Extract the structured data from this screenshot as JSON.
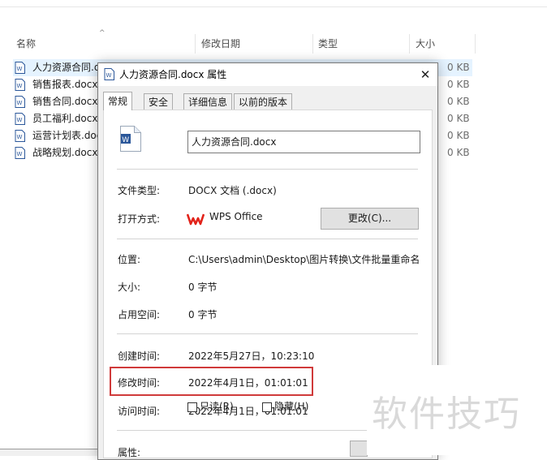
{
  "explorer": {
    "columns": {
      "name": "名称",
      "modified": "修改日期",
      "type": "类型",
      "size": "大小"
    },
    "files": [
      {
        "name": "人力资源合同.docx",
        "size": "0 KB",
        "selected": true
      },
      {
        "name": "销售报表.docx",
        "size": "0 KB",
        "selected": false
      },
      {
        "name": "销售合同.docx",
        "size": "0 KB",
        "selected": false
      },
      {
        "name": "员工福利.docx",
        "size": "0 KB",
        "selected": false
      },
      {
        "name": "运营计划表.docx",
        "size": "0 KB",
        "selected": false
      },
      {
        "name": "战略规划.docx",
        "size": "0 KB",
        "selected": false
      }
    ]
  },
  "dialog": {
    "title": "人力资源合同.docx 属性",
    "close_glyph": "✕",
    "tabs": [
      "常规",
      "安全",
      "详细信息",
      "以前的版本"
    ],
    "active_tab": "常规",
    "general": {
      "file_name": "人力资源合同.docx",
      "file_type_label": "文件类型:",
      "file_type_value": "DOCX 文档 (.docx)",
      "open_with_label": "打开方式:",
      "open_with_app": "WPS Office",
      "change_button": "更改(C)...",
      "location_label": "位置:",
      "location_value": "C:\\Users\\admin\\Desktop\\图片转换\\文件批量重命名",
      "size_label": "大小:",
      "size_value": "0 字节",
      "size_on_disk_label": "占用空间:",
      "size_on_disk_value": "0 字节",
      "created_label": "创建时间:",
      "created_value": "2022年5月27日，10:23:10",
      "modified_label": "修改时间:",
      "modified_value": "2022年4月1日，01:01:01",
      "accessed_label": "访问时间:",
      "accessed_value": "2022年4月1日，01:01:01",
      "attributes_label": "属性:",
      "readonly_label": "只读(R)",
      "hidden_label": "隐藏(H)"
    }
  },
  "watermark": "软件技巧",
  "colors": {
    "accent_highlight": "#d03a3a",
    "selection": "#e5f3ff",
    "word_icon": "#2b579a",
    "wps_icon": "#e2231a"
  },
  "icons": {
    "file": "word-doc-icon",
    "wps": "wps-logo-icon",
    "sort": "sort-up-icon"
  }
}
